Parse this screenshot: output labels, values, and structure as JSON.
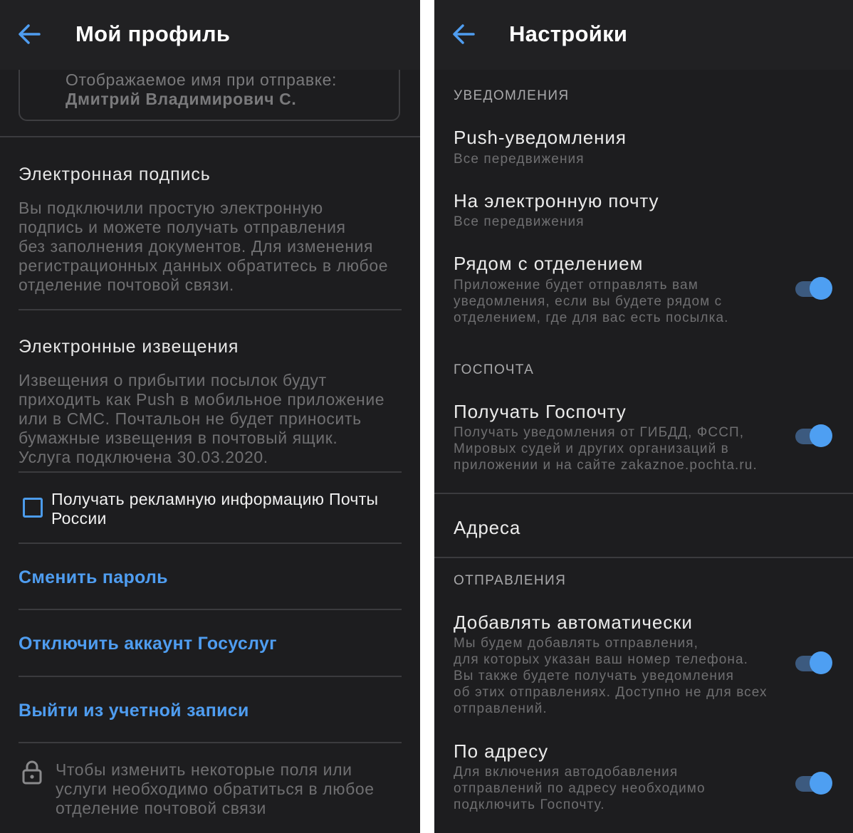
{
  "left_screen": {
    "title": "Мой профиль",
    "display_name": {
      "label": "Отображаемое имя при отправке:",
      "value": "Дмитрий Владимирович С."
    },
    "e_signature": {
      "title": "Электронная подпись",
      "lines": [
        "Вы подключили простую электронную",
        "подпись и можете получать отправления",
        "без заполнения документов. Для изменения",
        "регистрационных данных обратитесь в любое",
        "отделение почтовой связи."
      ]
    },
    "e_notices": {
      "title": "Электронные извещения",
      "lines": [
        "Извещения о прибытии посылок будут",
        "приходить как Push в мобильное приложение",
        "или в СМС. Почтальон не будет приносить",
        "бумажные извещения в почтовый ящик.",
        "Услуга подключена 30.03.2020."
      ]
    },
    "ads_checkbox": {
      "checked": false,
      "lines": [
        "Получать рекламную информацию Почты",
        "России"
      ]
    },
    "links": {
      "change_password": "Сменить пароль",
      "disconnect_gosuslugi": "Отключить аккаунт Госуслуг",
      "logout": "Выйти из учетной записи"
    },
    "lock_note": {
      "icon": "lock-icon",
      "lines": [
        "Чтобы изменить некоторые поля или",
        "услуги необходимо обратиться в любое",
        "отделение почтовой связи"
      ]
    }
  },
  "right_screen": {
    "title": "Настройки",
    "notifications": {
      "header": "УВЕДОМЛЕНИЯ",
      "push": {
        "title": "Push-уведомления",
        "sub": "Все передвижения"
      },
      "email": {
        "title": "На электронную почту",
        "sub": "Все передвижения"
      },
      "nearby": {
        "title": "Рядом с отделением",
        "lines": [
          "Приложение будет отправлять вам",
          "уведомления, если вы будете рядом с",
          "отделением, где для вас есть посылка."
        ],
        "enabled": true
      }
    },
    "gospochta": {
      "header": "ГОСПОЧТА",
      "receive": {
        "title": "Получать Госпочту",
        "lines": [
          "Получать уведомления от ГИБДД, ФССП,",
          "Мировых судей и других организаций в",
          "приложении и на сайте zakaznoe.pochta.ru."
        ],
        "enabled": true
      }
    },
    "addresses": {
      "title": "Адреса"
    },
    "shipments": {
      "header": "ОТПРАВЛЕНИЯ",
      "auto_add": {
        "title": "Добавлять автоматически",
        "lines": [
          "Мы будем добавлять отправления,",
          "для которых указан ваш номер телефона.",
          "Вы также будете получать уведомления",
          "об этих отправлениях. Доступно не для всех",
          "отправлений."
        ],
        "enabled": true
      },
      "by_address": {
        "title": "По адресу",
        "lines": [
          "Для включения автодобавления",
          "отправлений по адресу необходимо",
          "подключить Госпочту."
        ],
        "enabled": true
      }
    }
  },
  "colors": {
    "background": "#1d1d1f",
    "accent": "#4f9df0",
    "toggle_thumb": "#4e9ff2",
    "toggle_track": "#3c5a7f",
    "divider": "#3b3b3e"
  }
}
